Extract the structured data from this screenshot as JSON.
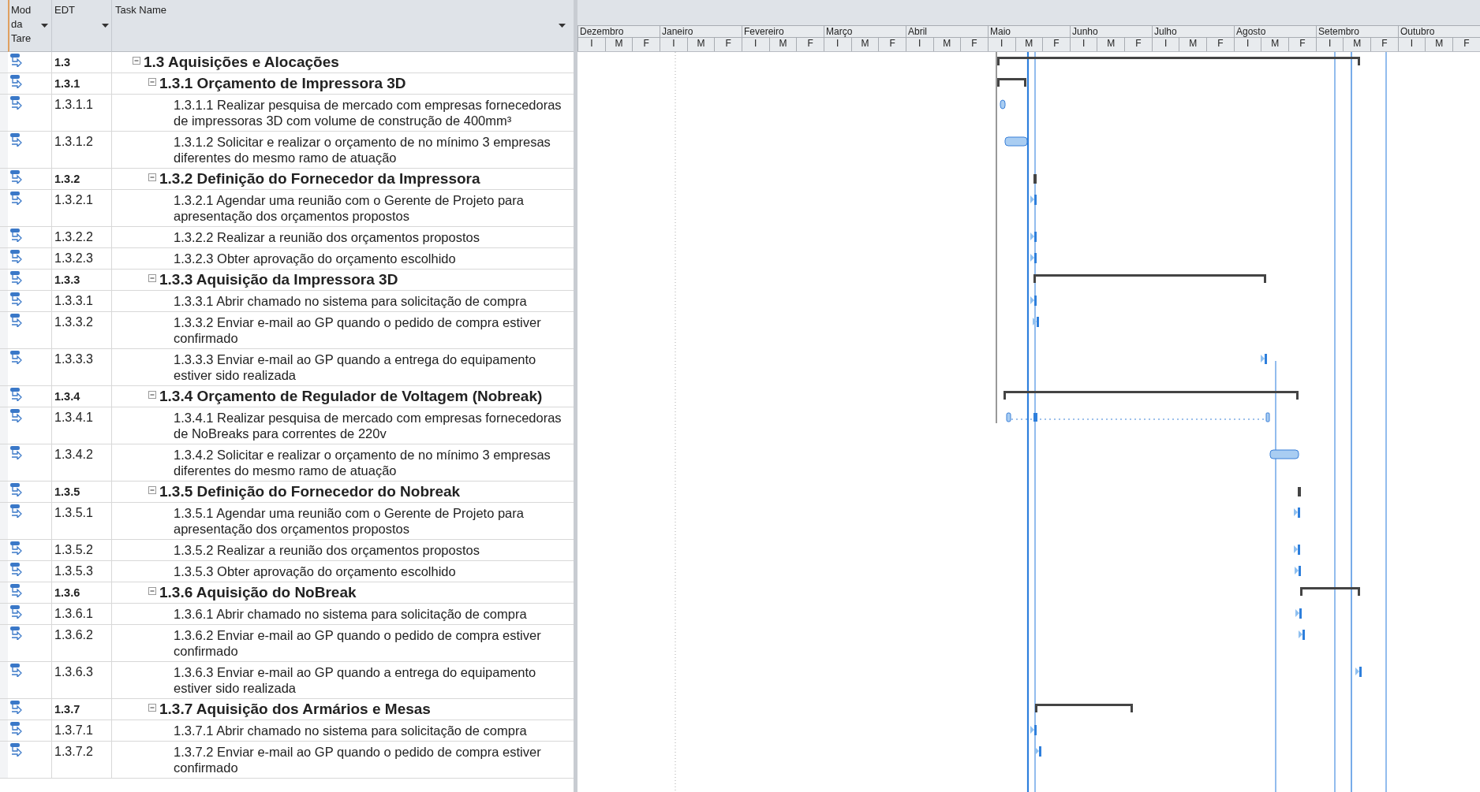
{
  "table": {
    "columns": [
      {
        "label": "Mod da Tare",
        "filter": true
      },
      {
        "label": "EDT",
        "filter": true
      },
      {
        "label": "Task Name",
        "filter": true
      }
    ],
    "rows": [
      {
        "edt": "1.3",
        "name": "1.3 Aquisições e Alocações",
        "expanded": true,
        "kind": "summary",
        "children": [
          {
            "edt": "1.3.1",
            "name": "1.3.1 Orçamento de Impressora 3D",
            "expanded": true,
            "kind": "summary",
            "children": [
              {
                "edt": "1.3.1.1",
                "name": "1.3.1.1 Realizar pesquisa de mercado com empresas fornecedoras de impressoras 3D com volume de construção de 400mm³",
                "kind": "task"
              },
              {
                "edt": "1.3.1.2",
                "name": "1.3.1.2 Solicitar e realizar o orçamento de no mínimo 3 empresas diferentes do mesmo ramo de atuação",
                "kind": "task"
              }
            ]
          },
          {
            "edt": "1.3.2",
            "name": "1.3.2 Definição do Fornecedor da Impressora",
            "expanded": true,
            "kind": "summary",
            "children": [
              {
                "edt": "1.3.2.1",
                "name": "1.3.2.1 Agendar uma reunião com o Gerente de Projeto para apresentação dos orçamentos propostos",
                "kind": "milestone"
              },
              {
                "edt": "1.3.2.2",
                "name": "1.3.2.2 Realizar a reunião dos orçamentos propostos",
                "kind": "milestone"
              },
              {
                "edt": "1.3.2.3",
                "name": "1.3.2.3 Obter aprovação do orçamento escolhido",
                "kind": "milestone"
              }
            ]
          },
          {
            "edt": "1.3.3",
            "name": "1.3.3 Aquisição da Impressora 3D",
            "expanded": true,
            "kind": "summary",
            "children": [
              {
                "edt": "1.3.3.1",
                "name": "1.3.3.1 Abrir chamado no sistema para solicitação de compra",
                "kind": "milestone"
              },
              {
                "edt": "1.3.3.2",
                "name": "1.3.3.2 Enviar e-mail ao GP quando o pedido de compra estiver confirmado",
                "kind": "milestone"
              },
              {
                "edt": "1.3.3.3",
                "name": "1.3.3.3 Enviar e-mail ao GP quando a entrega do equipamento estiver sido realizada",
                "kind": "milestone"
              }
            ]
          },
          {
            "edt": "1.3.4",
            "name": "1.3.4 Orçamento de Regulador de Voltagem (Nobreak)",
            "expanded": true,
            "kind": "summary",
            "children": [
              {
                "edt": "1.3.4.1",
                "name": "1.3.4.1 Realizar pesquisa de mercado com empresas fornecedoras de NoBreaks para correntes de 220v",
                "kind": "split"
              },
              {
                "edt": "1.3.4.2",
                "name": "1.3.4.2 Solicitar e realizar o orçamento de no mínimo 3 empresas diferentes do mesmo ramo de atuação",
                "kind": "task"
              }
            ]
          },
          {
            "edt": "1.3.5",
            "name": "1.3.5 Definição do Fornecedor do Nobreak",
            "expanded": true,
            "kind": "summary",
            "children": [
              {
                "edt": "1.3.5.1",
                "name": "1.3.5.1 Agendar uma reunião com o Gerente de Projeto para apresentação dos orçamentos propostos",
                "kind": "milestone"
              },
              {
                "edt": "1.3.5.2",
                "name": "1.3.5.2 Realizar a reunião dos orçamentos propostos",
                "kind": "milestone"
              },
              {
                "edt": "1.3.5.3",
                "name": "1.3.5.3 Obter aprovação do orçamento escolhido",
                "kind": "milestone"
              }
            ]
          },
          {
            "edt": "1.3.6",
            "name": "1.3.6 Aquisição do NoBreak",
            "expanded": true,
            "kind": "summary",
            "children": [
              {
                "edt": "1.3.6.1",
                "name": "1.3.6.1 Abrir chamado no sistema para solicitação de compra",
                "kind": "milestone"
              },
              {
                "edt": "1.3.6.2",
                "name": "1.3.6.2 Enviar e-mail ao GP quando o pedido de compra estiver confirmado",
                "kind": "milestone"
              },
              {
                "edt": "1.3.6.3",
                "name": "1.3.6.3 Enviar e-mail ao GP quando a entrega do equipamento estiver sido realizada",
                "kind": "milestone"
              }
            ]
          },
          {
            "edt": "1.3.7",
            "name": "1.3.7 Aquisição dos Armários e Mesas",
            "expanded": true,
            "kind": "summary",
            "children": [
              {
                "edt": "1.3.7.1",
                "name": "1.3.7.1 Abrir chamado no sistema para solicitação de compra",
                "kind": "milestone"
              },
              {
                "edt": "1.3.7.2",
                "name": "1.3.7.2 Enviar e-mail ao GP quando o pedido de compra estiver confirmado",
                "kind": "milestone"
              }
            ]
          }
        ]
      }
    ]
  },
  "timeline": {
    "months": [
      {
        "name": "Dezembro",
        "periods": [
          "I",
          "M",
          "F"
        ]
      },
      {
        "name": "Janeiro",
        "periods": [
          "I",
          "M",
          "F"
        ]
      },
      {
        "name": "Fevereiro",
        "periods": [
          "I",
          "M",
          "F"
        ]
      },
      {
        "name": "Março",
        "periods": [
          "I",
          "M",
          "F"
        ]
      },
      {
        "name": "Abril",
        "periods": [
          "I",
          "M",
          "F"
        ]
      },
      {
        "name": "Maio",
        "periods": [
          "I",
          "M",
          "F"
        ]
      },
      {
        "name": "Junho",
        "periods": [
          "I",
          "M",
          "F"
        ]
      },
      {
        "name": "Julho",
        "periods": [
          "I",
          "M",
          "F"
        ]
      },
      {
        "name": "Agosto",
        "periods": [
          "I",
          "M",
          "F"
        ]
      },
      {
        "name": "Setembro",
        "periods": [
          "I",
          "M",
          "F"
        ]
      },
      {
        "name": "Outubro",
        "periods": [
          "I",
          "M",
          "F"
        ]
      }
    ]
  }
}
